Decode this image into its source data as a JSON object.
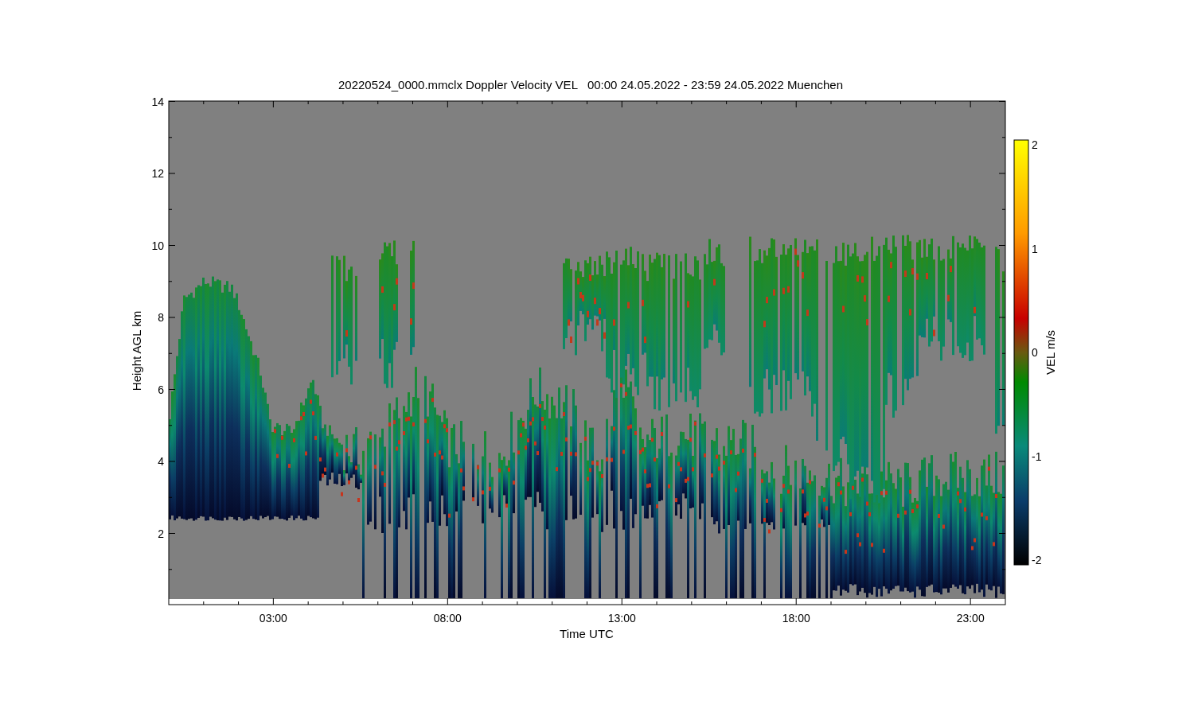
{
  "title": "20220524_0000.mmclx Doppler Velocity VEL   00:00 24.05.2022 - 23:59 24.05.2022 Muenchen",
  "y_axis": {
    "label": "Height AGL km",
    "ticks": [
      "14",
      "12",
      "10",
      "8",
      "6",
      "4",
      "2"
    ]
  },
  "x_axis": {
    "label": "Time UTC",
    "ticks": [
      "03:00",
      "08:00",
      "13:00",
      "18:00",
      "23:00"
    ]
  },
  "colorbar": {
    "label": "VEL m/s",
    "ticks": [
      "2",
      "1",
      "0",
      "-1",
      "-2"
    ]
  }
}
